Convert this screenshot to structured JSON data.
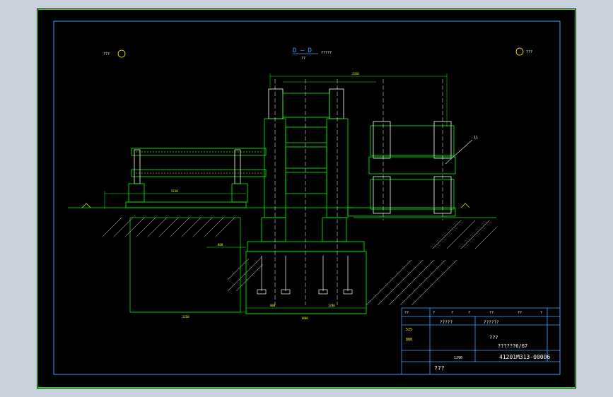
{
  "drawing": {
    "section_label": "D — D",
    "section_sub": "??",
    "section_note": "?????",
    "left_mark_text": "???",
    "right_mark_text": "???",
    "leader_number": "11",
    "dims": {
      "top_span": "2350",
      "left_run": "5210",
      "mid_a": "800",
      "mid_b": "800",
      "bottom_a": "1700",
      "bottom_b": "1800",
      "base_width": "2250"
    }
  },
  "title_block": {
    "header_cells": [
      "??",
      "?",
      "?",
      "?",
      "??",
      "??",
      "?"
    ],
    "row_texts": [
      "?????",
      "??????"
    ],
    "name": "???",
    "scale": "??????6/67",
    "side_a": "525",
    "side_b": "888",
    "mass": "1290",
    "code": "41201M313-00006",
    "footer_text": "???"
  },
  "colors": {
    "paper": "#000000",
    "frame": "#3aa0ff",
    "green": "#00ff00",
    "yellow": "#ffff00",
    "white": "#ffffff",
    "cyan": "#00ffff",
    "magenta": "#ff40ff"
  }
}
